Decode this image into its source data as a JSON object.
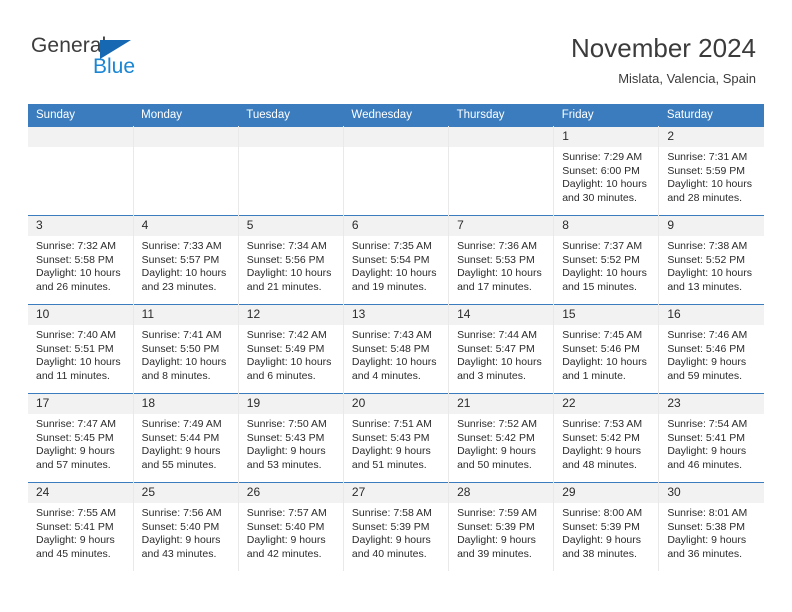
{
  "brand": {
    "name_part1": "General",
    "name_part2": "Blue",
    "triangle_color": "#1668b3",
    "blue_color": "#1b86d4"
  },
  "header": {
    "title": "November 2024",
    "location": "Mislata, Valencia, Spain"
  },
  "theme": {
    "header_bg": "#3a7cbe",
    "daynum_bg": "#f2f2f2",
    "text_color": "#2b2b2b"
  },
  "calendar": {
    "weekday_headers": [
      "Sunday",
      "Monday",
      "Tuesday",
      "Wednesday",
      "Thursday",
      "Friday",
      "Saturday"
    ],
    "weeks": [
      [
        {
          "day": "",
          "lines": []
        },
        {
          "day": "",
          "lines": []
        },
        {
          "day": "",
          "lines": []
        },
        {
          "day": "",
          "lines": []
        },
        {
          "day": "",
          "lines": []
        },
        {
          "day": "1",
          "lines": [
            "Sunrise: 7:29 AM",
            "Sunset: 6:00 PM",
            "Daylight: 10 hours and 30 minutes."
          ]
        },
        {
          "day": "2",
          "lines": [
            "Sunrise: 7:31 AM",
            "Sunset: 5:59 PM",
            "Daylight: 10 hours and 28 minutes."
          ]
        }
      ],
      [
        {
          "day": "3",
          "lines": [
            "Sunrise: 7:32 AM",
            "Sunset: 5:58 PM",
            "Daylight: 10 hours and 26 minutes."
          ]
        },
        {
          "day": "4",
          "lines": [
            "Sunrise: 7:33 AM",
            "Sunset: 5:57 PM",
            "Daylight: 10 hours and 23 minutes."
          ]
        },
        {
          "day": "5",
          "lines": [
            "Sunrise: 7:34 AM",
            "Sunset: 5:56 PM",
            "Daylight: 10 hours and 21 minutes."
          ]
        },
        {
          "day": "6",
          "lines": [
            "Sunrise: 7:35 AM",
            "Sunset: 5:54 PM",
            "Daylight: 10 hours and 19 minutes."
          ]
        },
        {
          "day": "7",
          "lines": [
            "Sunrise: 7:36 AM",
            "Sunset: 5:53 PM",
            "Daylight: 10 hours and 17 minutes."
          ]
        },
        {
          "day": "8",
          "lines": [
            "Sunrise: 7:37 AM",
            "Sunset: 5:52 PM",
            "Daylight: 10 hours and 15 minutes."
          ]
        },
        {
          "day": "9",
          "lines": [
            "Sunrise: 7:38 AM",
            "Sunset: 5:52 PM",
            "Daylight: 10 hours and 13 minutes."
          ]
        }
      ],
      [
        {
          "day": "10",
          "lines": [
            "Sunrise: 7:40 AM",
            "Sunset: 5:51 PM",
            "Daylight: 10 hours and 11 minutes."
          ]
        },
        {
          "day": "11",
          "lines": [
            "Sunrise: 7:41 AM",
            "Sunset: 5:50 PM",
            "Daylight: 10 hours and 8 minutes."
          ]
        },
        {
          "day": "12",
          "lines": [
            "Sunrise: 7:42 AM",
            "Sunset: 5:49 PM",
            "Daylight: 10 hours and 6 minutes."
          ]
        },
        {
          "day": "13",
          "lines": [
            "Sunrise: 7:43 AM",
            "Sunset: 5:48 PM",
            "Daylight: 10 hours and 4 minutes."
          ]
        },
        {
          "day": "14",
          "lines": [
            "Sunrise: 7:44 AM",
            "Sunset: 5:47 PM",
            "Daylight: 10 hours and 3 minutes."
          ]
        },
        {
          "day": "15",
          "lines": [
            "Sunrise: 7:45 AM",
            "Sunset: 5:46 PM",
            "Daylight: 10 hours and 1 minute."
          ]
        },
        {
          "day": "16",
          "lines": [
            "Sunrise: 7:46 AM",
            "Sunset: 5:46 PM",
            "Daylight: 9 hours and 59 minutes."
          ]
        }
      ],
      [
        {
          "day": "17",
          "lines": [
            "Sunrise: 7:47 AM",
            "Sunset: 5:45 PM",
            "Daylight: 9 hours and 57 minutes."
          ]
        },
        {
          "day": "18",
          "lines": [
            "Sunrise: 7:49 AM",
            "Sunset: 5:44 PM",
            "Daylight: 9 hours and 55 minutes."
          ]
        },
        {
          "day": "19",
          "lines": [
            "Sunrise: 7:50 AM",
            "Sunset: 5:43 PM",
            "Daylight: 9 hours and 53 minutes."
          ]
        },
        {
          "day": "20",
          "lines": [
            "Sunrise: 7:51 AM",
            "Sunset: 5:43 PM",
            "Daylight: 9 hours and 51 minutes."
          ]
        },
        {
          "day": "21",
          "lines": [
            "Sunrise: 7:52 AM",
            "Sunset: 5:42 PM",
            "Daylight: 9 hours and 50 minutes."
          ]
        },
        {
          "day": "22",
          "lines": [
            "Sunrise: 7:53 AM",
            "Sunset: 5:42 PM",
            "Daylight: 9 hours and 48 minutes."
          ]
        },
        {
          "day": "23",
          "lines": [
            "Sunrise: 7:54 AM",
            "Sunset: 5:41 PM",
            "Daylight: 9 hours and 46 minutes."
          ]
        }
      ],
      [
        {
          "day": "24",
          "lines": [
            "Sunrise: 7:55 AM",
            "Sunset: 5:41 PM",
            "Daylight: 9 hours and 45 minutes."
          ]
        },
        {
          "day": "25",
          "lines": [
            "Sunrise: 7:56 AM",
            "Sunset: 5:40 PM",
            "Daylight: 9 hours and 43 minutes."
          ]
        },
        {
          "day": "26",
          "lines": [
            "Sunrise: 7:57 AM",
            "Sunset: 5:40 PM",
            "Daylight: 9 hours and 42 minutes."
          ]
        },
        {
          "day": "27",
          "lines": [
            "Sunrise: 7:58 AM",
            "Sunset: 5:39 PM",
            "Daylight: 9 hours and 40 minutes."
          ]
        },
        {
          "day": "28",
          "lines": [
            "Sunrise: 7:59 AM",
            "Sunset: 5:39 PM",
            "Daylight: 9 hours and 39 minutes."
          ]
        },
        {
          "day": "29",
          "lines": [
            "Sunrise: 8:00 AM",
            "Sunset: 5:39 PM",
            "Daylight: 9 hours and 38 minutes."
          ]
        },
        {
          "day": "30",
          "lines": [
            "Sunrise: 8:01 AM",
            "Sunset: 5:38 PM",
            "Daylight: 9 hours and 36 minutes."
          ]
        }
      ]
    ]
  }
}
